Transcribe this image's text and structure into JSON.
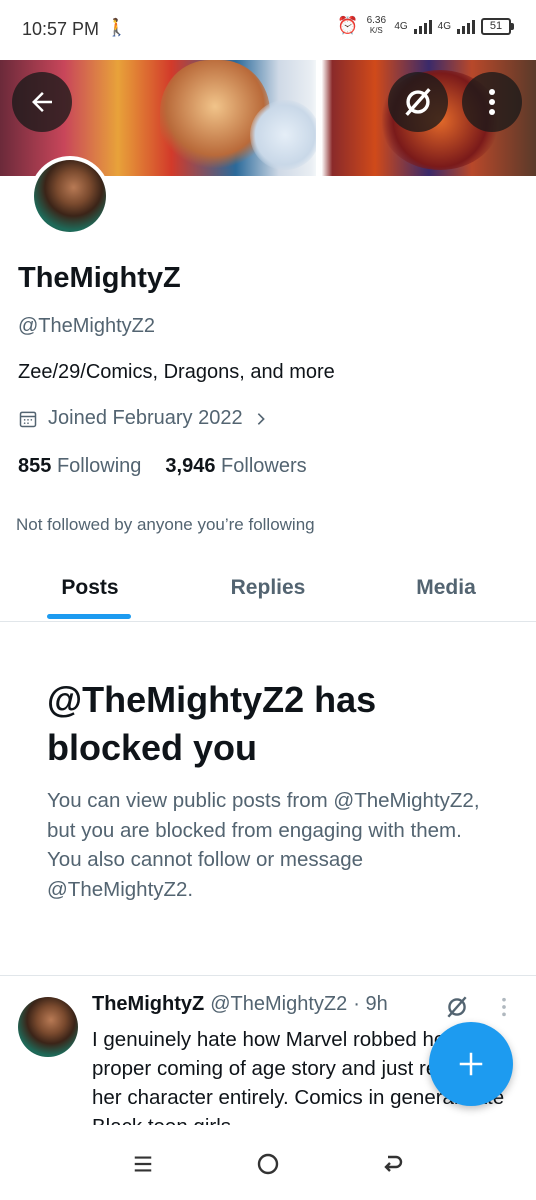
{
  "status_bar": {
    "time": "10:57 PM",
    "activity_icon": "walking-person-icon",
    "alarm_icon": "alarm-clock-icon",
    "speed_value": "6.36",
    "speed_unit": "K/S",
    "network1": "4G",
    "network2": "4G",
    "battery": "51"
  },
  "header": {
    "back_icon": "arrow-left-icon",
    "grok_icon": "grok-slash-circle-icon",
    "more_icon": "vertical-dots-icon"
  },
  "profile": {
    "display_name": "TheMightyZ",
    "handle": "@TheMightyZ2",
    "bio": "Zee/29/Comics, Dragons, and more",
    "joined": "Joined February 2022",
    "following_count": "855",
    "following_label": "Following",
    "followers_count": "3,946",
    "followers_label": "Followers",
    "not_followed": "Not followed by anyone you’re following"
  },
  "tabs": [
    {
      "label": "Posts",
      "active": true
    },
    {
      "label": "Replies",
      "active": false
    },
    {
      "label": "Media",
      "active": false
    }
  ],
  "blocked": {
    "title": "@TheMightyZ2 has blocked you",
    "description": "You can view public posts from @TheMightyZ2, but you are blocked from engaging with them. You also cannot follow or message @TheMightyZ2."
  },
  "tweet": {
    "name": "TheMightyZ",
    "handle": "@TheMightyZ2",
    "time": "· 9h",
    "text": "I genuinely hate how Marvel robbed her of a proper coming of age story and just reduced her character entirely. Comics in general hate Black teen girls"
  },
  "fab": {
    "icon": "plus-icon"
  },
  "nav": {
    "recents_icon": "menu-lines-icon",
    "home_icon": "circle-home-icon",
    "back_icon": "back-arrow-icon"
  },
  "colors": {
    "accent": "#1d9bf0",
    "text_primary": "#0f1419",
    "text_secondary": "#536471"
  }
}
